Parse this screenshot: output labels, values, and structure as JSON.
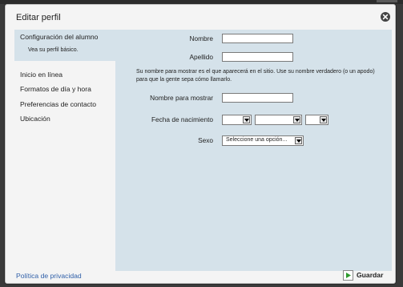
{
  "dialog": {
    "title": "Editar perfil"
  },
  "sidebar": {
    "active": {
      "label": "Configuración del alumno",
      "sublabel": "Vea su perfil básico."
    },
    "items": [
      {
        "label": "Inicio en línea"
      },
      {
        "label": "Formatos de día y hora"
      },
      {
        "label": "Preferencias de contacto"
      },
      {
        "label": "Ubicación"
      }
    ]
  },
  "form": {
    "first_name": {
      "label": "Nombre",
      "value": ""
    },
    "last_name": {
      "label": "Apellido",
      "value": ""
    },
    "display_name_help": "Su nombre para mostrar es el que aparecerá en el sitio. Use su nombre verdadero (o un apodo) para que la gente sepa cómo llamarlo.",
    "display_name": {
      "label": "Nombre para mostrar",
      "value": ""
    },
    "birthdate": {
      "label": "Fecha de nacimiento",
      "day": "",
      "month": "",
      "year": ""
    },
    "gender": {
      "label": "Sexo",
      "selected": "Seleccione una opción..."
    }
  },
  "footer": {
    "privacy_link": "Política de privacidad",
    "save_label": "Guardar"
  },
  "colors": {
    "panel": "#d5e2ea",
    "link": "#2f5fa8",
    "save_icon": "#2e9a2e"
  },
  "icons": {
    "close": "close-circle-icon",
    "save": "play-icon",
    "dropdown": "chevron-down-icon"
  }
}
